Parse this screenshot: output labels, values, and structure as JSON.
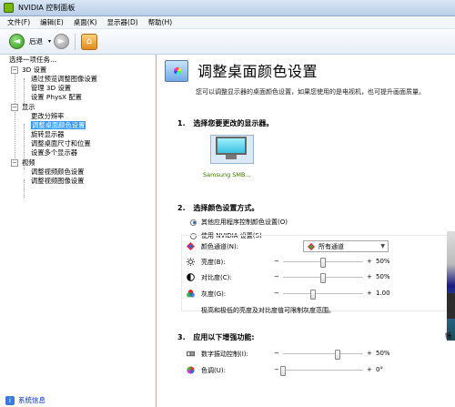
{
  "window": {
    "title": "NVIDIA 控制面板"
  },
  "menu": {
    "items": [
      "文件(F)",
      "编辑(E)",
      "桌面(K)",
      "显示器(D)",
      "帮助(H)"
    ]
  },
  "toolbar": {
    "back_label": "后退",
    "back_glyph": "◄",
    "forward_glyph": "►",
    "home_glyph": "⌂",
    "dropdown_glyph": "▾"
  },
  "sidebar": {
    "header": "选择一项任务...",
    "tree": [
      {
        "label": "3D 设置",
        "level": 0,
        "expander": "−"
      },
      {
        "label": "通过预览调整图像设置",
        "level": 1
      },
      {
        "label": "管理 3D 设置",
        "level": 1
      },
      {
        "label": "设置 PhysX 配置",
        "level": 1
      },
      {
        "label": "显示",
        "level": 0,
        "expander": "−"
      },
      {
        "label": "更改分辨率",
        "level": 1
      },
      {
        "label": "调整桌面颜色设置",
        "level": 1,
        "selected": true
      },
      {
        "label": "旋转显示器",
        "level": 1
      },
      {
        "label": "调整桌面尺寸和位置",
        "level": 1
      },
      {
        "label": "设置多个显示器",
        "level": 1
      },
      {
        "label": "视频",
        "level": 0,
        "expander": "−"
      },
      {
        "label": "调整视频颜色设置",
        "level": 1
      },
      {
        "label": "调整视频图像设置",
        "level": 1
      }
    ],
    "system_info": "系统信息"
  },
  "page": {
    "title": "调整桌面颜色设置",
    "description": "您可以调整显示器的桌面颜色设置，如果您使用的是电视机，也可提升画面质量。",
    "section1": {
      "num": "1.",
      "title": "选择您要更改的显示器。"
    },
    "display": {
      "label": "Samsung SMB..."
    },
    "section2": {
      "num": "2.",
      "title": "选择颜色设置方式。"
    },
    "radio_app": "其他应用程序控制颜色设置(O)",
    "radio_nvidia": "使用 NVIDIA 设置(S)",
    "channel_label": "颜色通道(N):",
    "channel_value": "所有通道",
    "brightness": {
      "label": "亮度(B):",
      "minus": "−",
      "plus": "+",
      "value": "50%",
      "level": 0.5
    },
    "contrast": {
      "label": "对比度(C):",
      "minus": "−",
      "plus": "+",
      "value": "50%",
      "level": 0.5
    },
    "gamma": {
      "label": "灰度(G):",
      "minus": "−",
      "plus": "+",
      "value": "1.00",
      "level": 0.38
    },
    "note": "极高和极低的亮度及对比度值可限制灰度范围。",
    "section3": {
      "num": "3.",
      "title": "应用以下增强功能:"
    },
    "vibrance": {
      "label": "数字振动控制(I):",
      "minus": "−",
      "plus": "+",
      "value": "50%",
      "level": 0.68
    },
    "hue": {
      "label": "色调(U):",
      "minus": "−",
      "plus": "+",
      "value": "0°",
      "level": 0.0
    },
    "mirror_label": "镜"
  },
  "colors": {
    "selected": "#3399ff",
    "brand": "#76b900",
    "display_label": "#3a6f00"
  }
}
